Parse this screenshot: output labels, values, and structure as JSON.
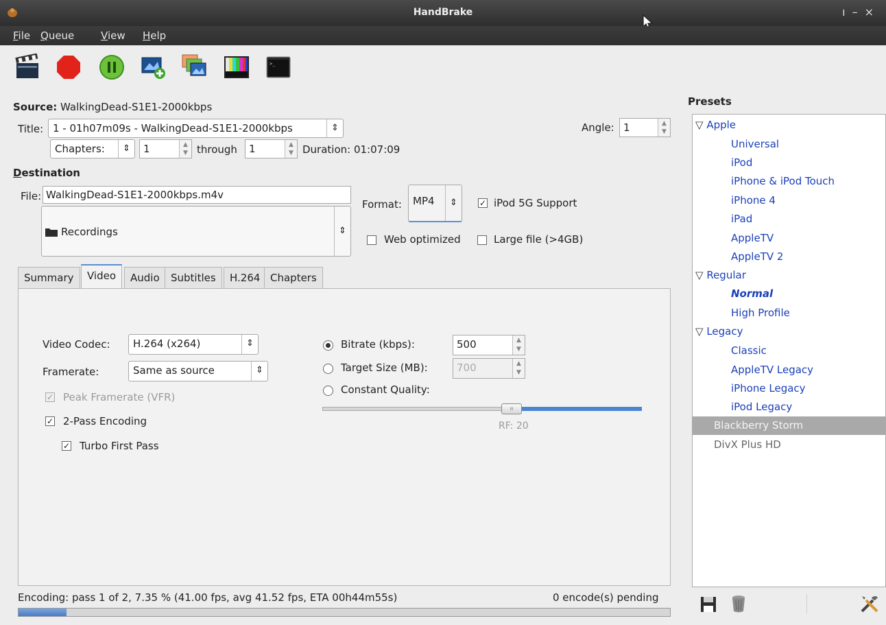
{
  "window": {
    "title": "HandBrake"
  },
  "menu": [
    {
      "label": "File",
      "mnemonic": "F",
      "rest": "ile"
    },
    {
      "label": "Queue",
      "mnemonic": "Q",
      "rest": "ueue"
    },
    {
      "label": "View",
      "mnemonic": "V",
      "rest": "iew"
    },
    {
      "label": "Help",
      "mnemonic": "H",
      "rest": "elp"
    }
  ],
  "toolbar": {
    "icons": [
      "start-encode-icon",
      "stop-icon",
      "pause-icon",
      "add-to-queue-icon",
      "show-queue-icon",
      "preview-icon",
      "activity-log-icon"
    ]
  },
  "source": {
    "label": "Source:",
    "value": "WalkingDead-S1E1-2000kbps",
    "title_label": "Title:",
    "title_value": "1 - 01h07m09s - WalkingDead-S1E1-2000kbps",
    "angle_label": "Angle:",
    "angle_value": "1",
    "chapters_mode": "Chapters:",
    "chapter_start": "1",
    "through_label": "through",
    "chapter_end": "1",
    "duration_label": "Duration: 01:07:09"
  },
  "destination": {
    "heading": "Destination",
    "heading_mnemonic": "D",
    "heading_rest": "estination",
    "file_label": "File:",
    "file_value": "WalkingDead-S1E1-2000kbps.m4v",
    "folder": "Recordings",
    "format_label": "Format:",
    "format_value": "MP4",
    "ipod_label": "iPod 5G Support",
    "ipod_checked": true,
    "web_label": "Web optimized",
    "web_checked": false,
    "large_label": "Large file (>4GB)",
    "large_checked": false
  },
  "tabs": [
    "Summary",
    "Video",
    "Audio",
    "Subtitles",
    "H.264",
    "Chapters"
  ],
  "active_tab": "Video",
  "video": {
    "codec_label": "Video Codec:",
    "codec_value": "H.264 (x264)",
    "framerate_label": "Framerate:",
    "framerate_value": "Same as source",
    "peak_label": "Peak Framerate (VFR)",
    "twopass_label": "2-Pass Encoding",
    "turbo_label": "Turbo First Pass",
    "bitrate_label": "Bitrate (kbps):",
    "bitrate_value": "500",
    "target_label": "Target Size (MB):",
    "target_value": "700",
    "quality_label": "Constant Quality:",
    "rf_label": "RF: 20",
    "slider_fraction": 0.59
  },
  "presets": {
    "heading": "Presets",
    "groups": [
      {
        "name": "Apple",
        "items": [
          "Universal",
          "iPod",
          "iPhone & iPod Touch",
          "iPhone 4",
          "iPad",
          "AppleTV",
          "AppleTV 2"
        ]
      },
      {
        "name": "Regular",
        "items": [
          "Normal",
          "High Profile"
        ]
      },
      {
        "name": "Legacy",
        "items": [
          "Classic",
          "AppleTV Legacy",
          "iPhone Legacy",
          "iPod Legacy"
        ]
      }
    ],
    "selected": "Blackberry Storm",
    "other": "DivX Plus HD"
  },
  "status": {
    "text": "Encoding: pass 1 of 2, 7.35 % (41.00 fps, avg 41.52 fps, ETA 00h44m55s)",
    "pending": "0 encode(s) pending",
    "progress": 0.0735
  },
  "colors": {
    "preset_link": "#1a3fb8",
    "selected_bg": "#a9a9a9",
    "slider_fill": "#4a86d0"
  }
}
